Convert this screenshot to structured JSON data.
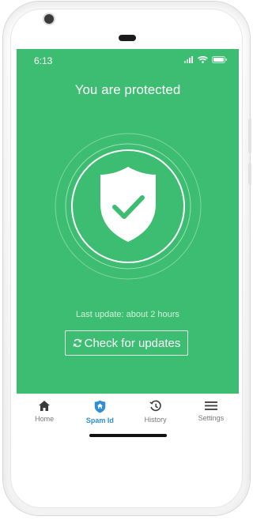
{
  "status_bar": {
    "time": "6:13"
  },
  "main": {
    "title": "You are protected",
    "last_update": "Last update: about 2 hours",
    "check_button_label": "Check for updates"
  },
  "tabs": [
    {
      "label": "Home",
      "icon": "home-icon",
      "active": false
    },
    {
      "label": "Spam Id",
      "icon": "shield-home-icon",
      "active": true
    },
    {
      "label": "History",
      "icon": "history-icon",
      "active": false
    },
    {
      "label": "Settings",
      "icon": "hamburger-menu-icon",
      "active": false
    }
  ],
  "colors": {
    "app_background": "#3dbd71",
    "active_tab": "#2f8fd6",
    "inactive_tab": "#777777"
  }
}
